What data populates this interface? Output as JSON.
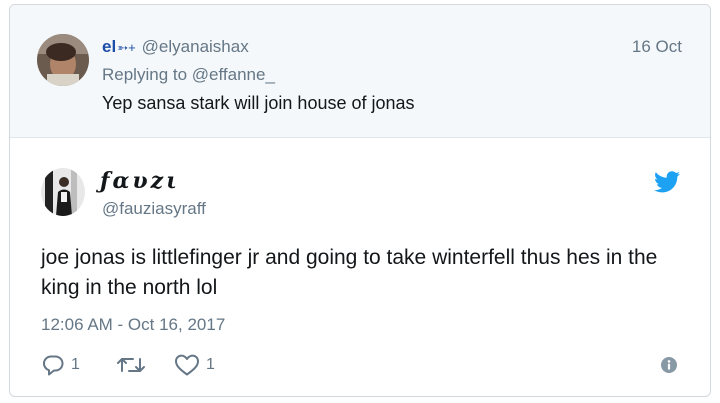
{
  "parent_tweet": {
    "display_name": "el",
    "display_name_suffix": "➳+",
    "handle": "@elyanaishax",
    "date": "16 Oct",
    "replying_to": "Replying to @effanne_",
    "text": "Yep sansa stark will join house of jonas"
  },
  "main_tweet": {
    "display_name": "ƒαυzι",
    "handle": "@fauziasyraff",
    "text": "joe jonas is littlefinger jr and going to take winterfell thus hes in the king in the north lol",
    "timestamp": "12:06 AM - Oct 16, 2017",
    "actions": {
      "reply_count": "1",
      "like_count": "1"
    },
    "icons": {
      "brand": "twitter-bird-icon",
      "reply": "reply-icon",
      "retweet": "retweet-icon",
      "like": "heart-icon",
      "info": "info-icon"
    }
  },
  "colors": {
    "twitter_blue": "#1da1f2",
    "secondary_text": "#657786",
    "name_blue": "#1d4ea8",
    "parent_background": "#f5f8fa"
  }
}
